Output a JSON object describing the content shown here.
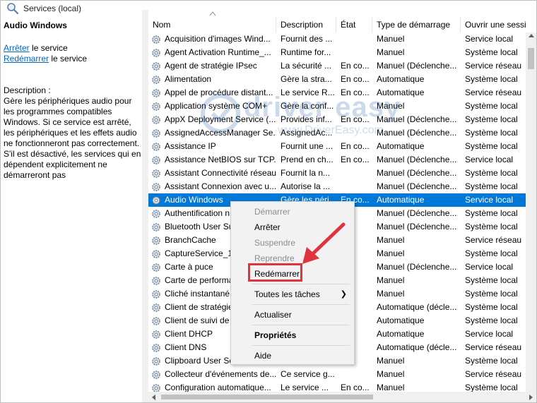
{
  "window": {
    "title": "Services (local)"
  },
  "left_panel": {
    "service_title": "Audio Windows",
    "stop_link": "Arrêter",
    "stop_suffix": " le service",
    "restart_link": "Redémarrer",
    "restart_suffix": " le service",
    "description_label": "Description :",
    "description": "Gère les périphériques audio pour les programmes compatibles Windows. Si ce service est arrêté, les périphériques et les effets audio ne fonctionneront pas correctement. S'il est désactivé, les services qui en dépendent explicitement ne démarreront pas"
  },
  "columns": [
    "Nom",
    "Description",
    "État",
    "Type de démarrage",
    "Ouvrir une sessi"
  ],
  "rows": [
    {
      "name": "Acquisition d'images Wind...",
      "desc": "Fournit des ...",
      "state": "",
      "start": "Manuel",
      "open": "Service local"
    },
    {
      "name": "Agent Activation Runtime_...",
      "desc": "Runtime for...",
      "state": "",
      "start": "Manuel",
      "open": "Système local"
    },
    {
      "name": "Agent de stratégie IPsec",
      "desc": "La sécurité ...",
      "state": "En co...",
      "start": "Manuel (Déclenche...",
      "open": "Service réseau"
    },
    {
      "name": "Alimentation",
      "desc": "Gère la stra...",
      "state": "En co...",
      "start": "Automatique",
      "open": "Système local"
    },
    {
      "name": "Appel de procédure distant...",
      "desc": "Le service R...",
      "state": "En co...",
      "start": "Automatique",
      "open": "Service réseau"
    },
    {
      "name": "Application système COM+",
      "desc": "Gère la conf...",
      "state": "",
      "start": "Manuel",
      "open": "Système local"
    },
    {
      "name": "AppX Deployment Service (...",
      "desc": "Provides inf...",
      "state": "En co...",
      "start": "Manuel (Déclenche...",
      "open": "Système local"
    },
    {
      "name": "AssignedAccessManager Se...",
      "desc": "AssignedAc...",
      "state": "",
      "start": "Manuel (Déclenche...",
      "open": "Système local"
    },
    {
      "name": "Assistance IP",
      "desc": "Fournit une ...",
      "state": "En co...",
      "start": "Automatique",
      "open": "Système local"
    },
    {
      "name": "Assistance NetBIOS sur TCP...",
      "desc": "Prend en ch...",
      "state": "En co...",
      "start": "Manuel (Déclenche...",
      "open": "Service local"
    },
    {
      "name": "Assistant Connectivité réseau",
      "desc": "Fournit la n...",
      "state": "",
      "start": "Manuel (Déclenche...",
      "open": "Système local"
    },
    {
      "name": "Assistant Connexion avec u...",
      "desc": "Autorise la ...",
      "state": "",
      "start": "Manuel (Déclenche...",
      "open": "Système local"
    },
    {
      "name": "Audio Windows",
      "desc": "Gère les péri...",
      "state": "En co...",
      "start": "Automatique",
      "open": "Service local",
      "selected": true
    },
    {
      "name": "Authentification n",
      "desc": "",
      "state": "",
      "start": "Manuel (Déclenche...",
      "open": "Système local"
    },
    {
      "name": "Bluetooth User Su",
      "desc": "",
      "state": "",
      "start": "Manuel (Déclenche...",
      "open": "Système local"
    },
    {
      "name": "BranchCache",
      "desc": "",
      "state": "",
      "start": "Manuel",
      "open": "Service réseau"
    },
    {
      "name": "CaptureService_1f",
      "desc": "",
      "state": "",
      "start": "Manuel",
      "open": "Système local"
    },
    {
      "name": "Carte à puce",
      "desc": "",
      "state": "",
      "start": "Manuel (Déclenche...",
      "open": "Service local"
    },
    {
      "name": "Carte de performa",
      "desc": "",
      "state": "",
      "start": "Manuel",
      "open": "Système local"
    },
    {
      "name": "Cliché instantané",
      "desc": "",
      "state": "",
      "start": "Manuel",
      "open": "Système local"
    },
    {
      "name": "Client de stratégie",
      "desc": "",
      "state": "",
      "start": "Automatique (décle...",
      "open": "Système local"
    },
    {
      "name": "Client de suivi de",
      "desc": "",
      "state": "",
      "start": "Automatique",
      "open": "Système local"
    },
    {
      "name": "Client DHCP",
      "desc": "",
      "state": "",
      "start": "Automatique",
      "open": "Service local"
    },
    {
      "name": "Client DNS",
      "desc": "",
      "state": "",
      "start": "Automatique (décle...",
      "open": "Service réseau"
    },
    {
      "name": "Clipboard User Se",
      "desc": "",
      "state": "",
      "start": "Manuel",
      "open": "Système local"
    },
    {
      "name": "Collecteur d'événements de...",
      "desc": "Ce service g...",
      "state": "",
      "start": "Manuel",
      "open": "Service réseau"
    },
    {
      "name": "Configuration automatique...",
      "desc": "Le service ...",
      "state": "En co...",
      "start": "Manuel",
      "open": "Système local"
    }
  ],
  "context_menu": {
    "start": "Démarrer",
    "stop": "Arrêter",
    "pause": "Suspendre",
    "resume": "Reprendre",
    "restart": "Redémarrer",
    "all_tasks": "Toutes les tâches",
    "refresh": "Actualiser",
    "properties": "Propriétés",
    "help": "Aide"
  },
  "watermark": {
    "brand": "driver easy",
    "url": "www.DriverEasy.com"
  },
  "colors": {
    "selection": "#0078d7",
    "link": "#0066cc",
    "highlight": "#e0333c"
  }
}
